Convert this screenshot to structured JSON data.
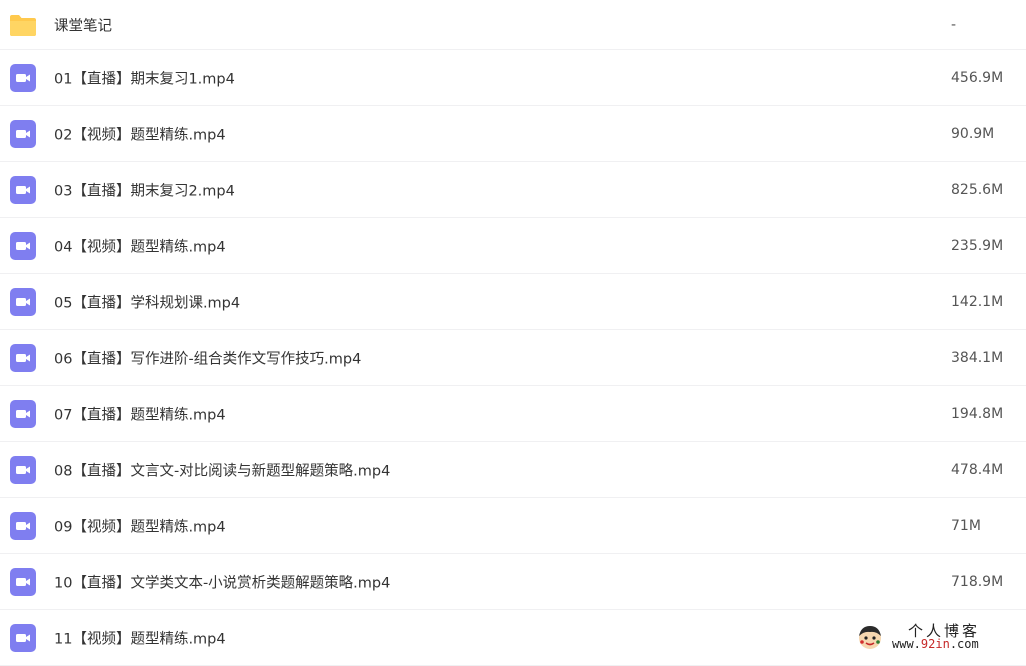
{
  "files": [
    {
      "icon": "folder-icon",
      "name": "课堂笔记",
      "size": "-"
    },
    {
      "icon": "video-file-icon",
      "name": "01【直播】期末复习1.mp4",
      "size": "456.9M"
    },
    {
      "icon": "video-file-icon",
      "name": "02【视频】题型精练.mp4",
      "size": "90.9M"
    },
    {
      "icon": "video-file-icon",
      "name": "03【直播】期末复习2.mp4",
      "size": "825.6M"
    },
    {
      "icon": "video-file-icon",
      "name": "04【视频】题型精练.mp4",
      "size": "235.9M"
    },
    {
      "icon": "video-file-icon",
      "name": "05【直播】学科规划课.mp4",
      "size": "142.1M"
    },
    {
      "icon": "video-file-icon",
      "name": "06【直播】写作进阶-组合类作文写作技巧.mp4",
      "size": "384.1M"
    },
    {
      "icon": "video-file-icon",
      "name": "07【直播】题型精练.mp4",
      "size": "194.8M"
    },
    {
      "icon": "video-file-icon",
      "name": "08【直播】文言文-对比阅读与新题型解题策略.mp4",
      "size": "478.4M"
    },
    {
      "icon": "video-file-icon",
      "name": "09【视频】题型精炼.mp4",
      "size": "71M"
    },
    {
      "icon": "video-file-icon",
      "name": "10【直播】文学类文本-小说赏析类题解题策略.mp4",
      "size": "718.9M"
    },
    {
      "icon": "video-file-icon",
      "name": "11【视频】题型精练.mp4",
      "size": ""
    }
  ],
  "colors": {
    "folder": "#ffc94d",
    "video_icon": "#7f7ef0",
    "row_divider": "#f0f0f2"
  },
  "watermark": {
    "title": "个人博客",
    "url_prefix": "www.",
    "url_highlight": "92in",
    "url_suffix": ".com"
  }
}
